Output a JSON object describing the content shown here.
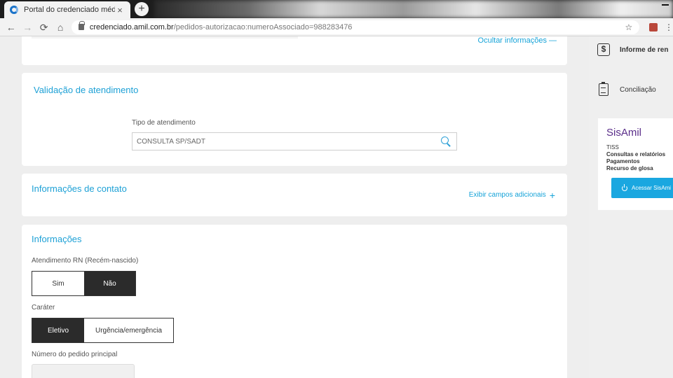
{
  "browser": {
    "tab_title": "Portal do credenciado médico",
    "tab_close": "×",
    "new_tab": "+",
    "url_host": "credenciado.amil.com.br",
    "url_path": "/pedidos-autorizacao:numeroAssociado=988283476",
    "nav": {
      "back": "←",
      "forward": "→",
      "reload": "⟳",
      "home": "⌂"
    },
    "star": "☆",
    "menu": "⋮"
  },
  "top_card": {
    "link": "Ocultar informações —"
  },
  "validacao": {
    "title": "Validação de atendimento",
    "field_label": "Tipo de atendimento",
    "field_value": "CONSULTA SP/SADT"
  },
  "contato": {
    "title": "Informações de contato",
    "link": "Exibir campos adicionais",
    "plus": "+"
  },
  "info": {
    "title": "Informações",
    "rn_label": "Atendimento RN (Recém-nascido)",
    "rn_options": [
      "Sim",
      "Não"
    ],
    "rn_selected": "Não",
    "carater_label": "Caráter",
    "carater_options": [
      "Eletivo",
      "Urgência/emergência"
    ],
    "carater_selected": "Eletivo",
    "pedido_label": "Número do pedido principal"
  },
  "sidebar": {
    "informe_label": "Informe de ren",
    "conciliacao_label": "Conciliação",
    "dollar_glyph": "$",
    "sisamil": {
      "brand": "SisAmil",
      "line1": "TISS",
      "line2": "Consultas e relatórios",
      "line3": "Pagamentos",
      "line4": "Recurso de glosa",
      "button": "Acessar SisAmi"
    }
  }
}
